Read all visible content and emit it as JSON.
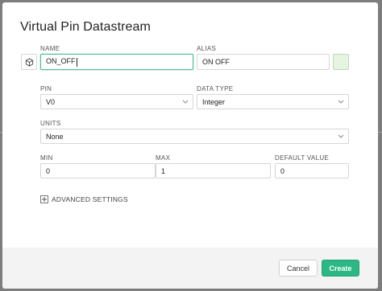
{
  "dialog": {
    "title": "Virtual Pin Datastream"
  },
  "name": {
    "label": "NAME",
    "value": "ON_OFF"
  },
  "alias": {
    "label": "ALIAS",
    "value": "ON OFF"
  },
  "color": {
    "value": "#e6f4e1"
  },
  "pin": {
    "label": "PIN",
    "value": "V0"
  },
  "data_type": {
    "label": "DATA TYPE",
    "value": "Integer"
  },
  "units": {
    "label": "UNITS",
    "value": "None"
  },
  "min": {
    "label": "MIN",
    "value": "0"
  },
  "max": {
    "label": "MAX",
    "value": "1"
  },
  "default_value": {
    "label": "DEFAULT VALUE",
    "value": "0"
  },
  "advanced": {
    "label": "ADVANCED SETTINGS"
  },
  "footer": {
    "cancel_label": "Cancel",
    "create_label": "Create"
  },
  "icons": {
    "datastream": "cube-icon",
    "chevron": "chevron-down-icon",
    "expand": "plus-icon"
  },
  "colors": {
    "accent": "#2bb884",
    "focus_border": "#4ec19a"
  }
}
